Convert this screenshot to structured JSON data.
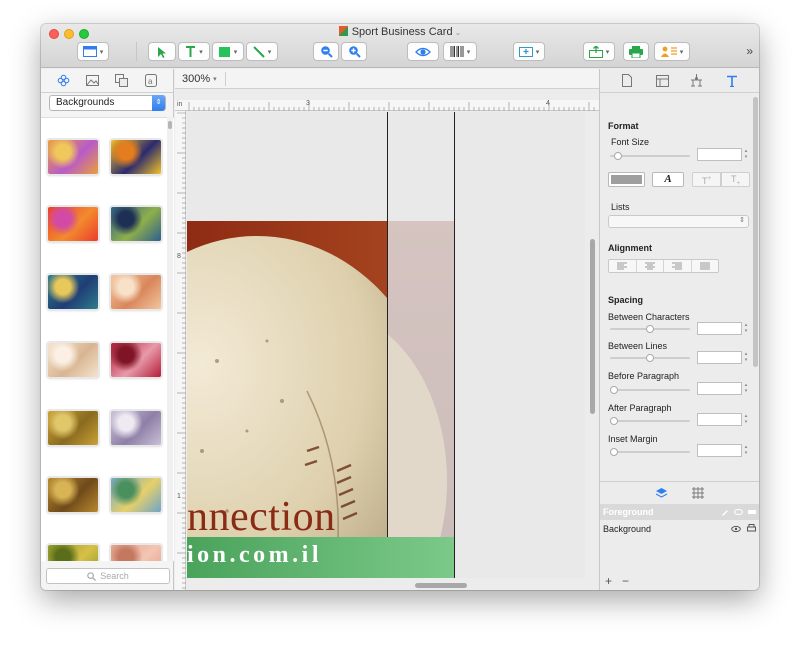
{
  "window": {
    "title": "Sport Business Card"
  },
  "left_panel": {
    "dropdown_value": "Backgrounds",
    "search_placeholder": "Search",
    "thumbnails": [
      {
        "colors": [
          "#e8a03a",
          "#b95ac9",
          "#f0c75a"
        ]
      },
      {
        "colors": [
          "#f2c327",
          "#2b2a6e",
          "#e47d1d"
        ]
      },
      {
        "colors": [
          "#ec3e2b",
          "#f28b2e",
          "#d24aa5"
        ]
      },
      {
        "colors": [
          "#2e5e8f",
          "#8fb04a",
          "#1d2f55"
        ]
      },
      {
        "colors": [
          "#2e7d8c",
          "#1f3d75",
          "#e9c85a"
        ]
      },
      {
        "colors": [
          "#f2c6a0",
          "#d9865a",
          "#f8e1c8"
        ]
      },
      {
        "colors": [
          "#f4e3cf",
          "#d8b591",
          "#fbf0e3"
        ]
      },
      {
        "colors": [
          "#b21d3a",
          "#e89aa9",
          "#7e1426"
        ]
      },
      {
        "colors": [
          "#c9a336",
          "#8a6a1f",
          "#e0c76a"
        ]
      },
      {
        "colors": [
          "#c9c0d6",
          "#8e7fa7",
          "#efe9f2"
        ]
      },
      {
        "colors": [
          "#b8892f",
          "#6f4a1a",
          "#d8b456"
        ]
      },
      {
        "colors": [
          "#6fa5c8",
          "#e6d06a",
          "#4a8f5e"
        ]
      },
      {
        "colors": [
          "#8a9a2a",
          "#d8c047",
          "#5a6e1a"
        ]
      },
      {
        "colors": [
          "#e3a088",
          "#f2c6b3",
          "#c47860"
        ]
      }
    ]
  },
  "canvas": {
    "zoom": "300%",
    "ruler_unit": "in",
    "ruler_top_labels": [
      "3",
      "4"
    ],
    "ruler_left_labels": [
      "8",
      "1"
    ],
    "card_text_line1": "nnection",
    "card_text_line2": "ion.com.il"
  },
  "right_panel": {
    "format_heading": "Format",
    "font_size_label": "Font Size",
    "lists_label": "Lists",
    "alignment_heading": "Alignment",
    "spacing_heading": "Spacing",
    "between_characters_label": "Between Characters",
    "between_lines_label": "Between Lines",
    "before_paragraph_label": "Before Paragraph",
    "after_paragraph_label": "After Paragraph",
    "inset_margin_label": "Inset Margin",
    "layer_header": "Foreground",
    "layer_name": "Background",
    "add_symbol": "+",
    "remove_symbol": "−"
  }
}
